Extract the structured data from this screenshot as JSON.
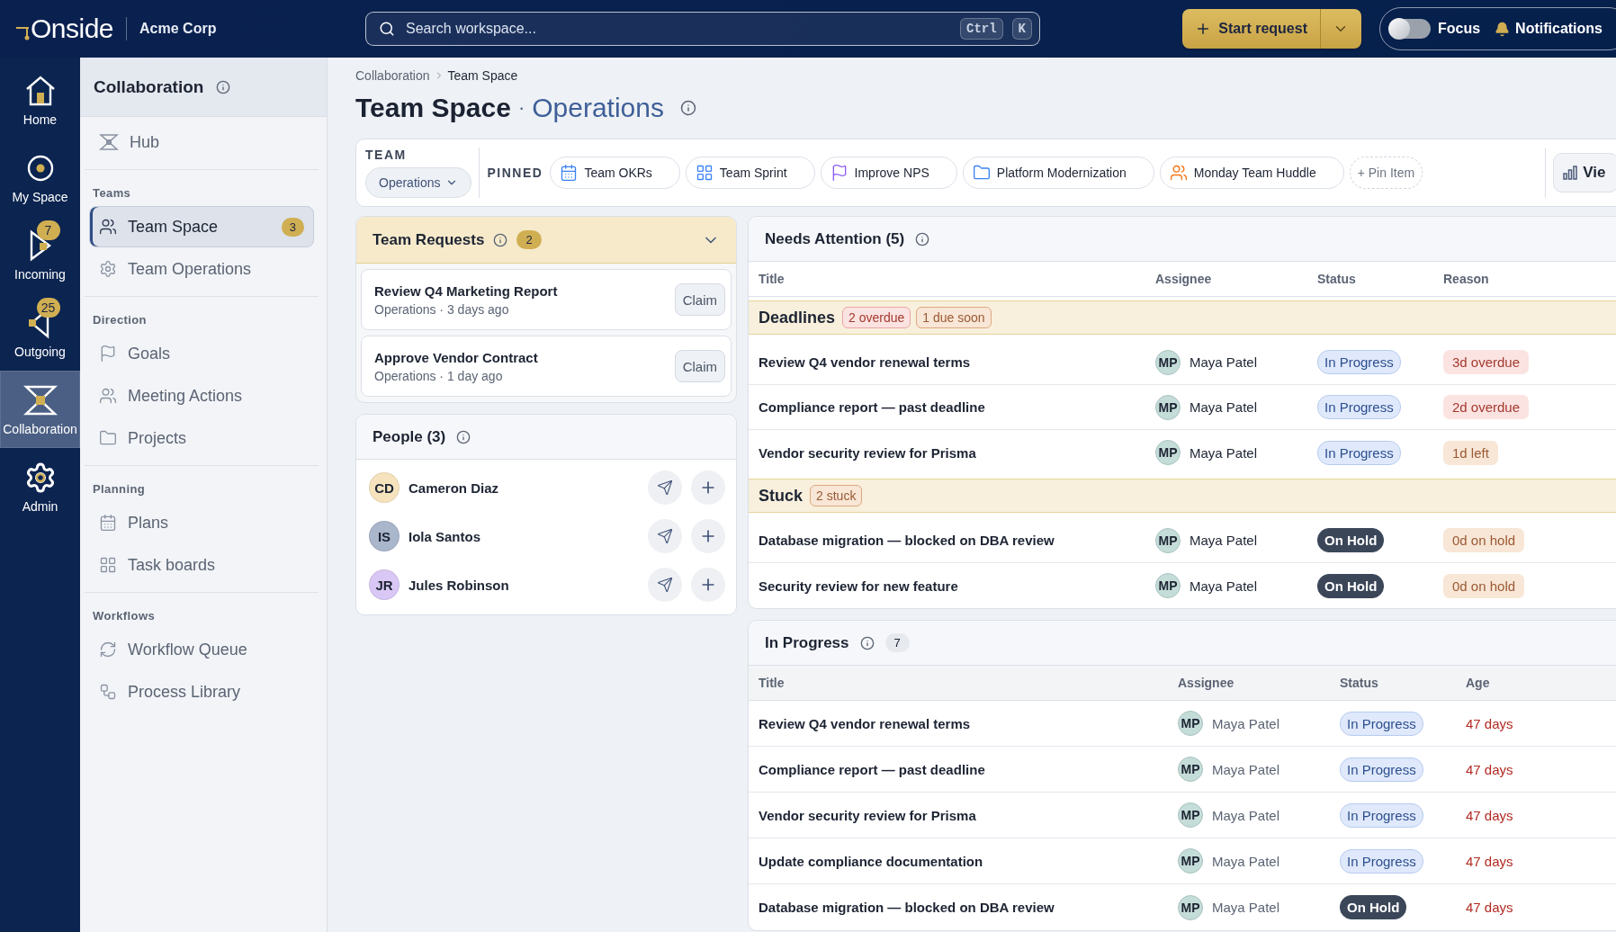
{
  "topbar": {
    "logo": "Onside",
    "org": "Acme Corp",
    "search": {
      "placeholder": "Search workspace...",
      "keys": [
        "Ctrl",
        "K"
      ]
    },
    "primary_action": "Start request",
    "focus": {
      "label": "Focus",
      "on": false
    },
    "notifications": "Notifications"
  },
  "rail": [
    {
      "label": "Home",
      "kind": "home",
      "selected": false
    },
    {
      "label": "My Space",
      "kind": "target",
      "selected": false
    },
    {
      "label": "Incoming",
      "kind": "incoming",
      "badge": "7",
      "selected": false
    },
    {
      "label": "Outgoing",
      "kind": "outgoing",
      "badge": "25",
      "selected": false
    },
    {
      "label": "Collaboration",
      "kind": "collab",
      "selected": true
    },
    {
      "label": "Admin",
      "kind": "gear",
      "selected": false
    }
  ],
  "sidebar": {
    "title": "Collaboration",
    "groups": [
      {
        "items": [
          {
            "label": "Hub",
            "kind": "hub",
            "selected": false
          }
        ]
      },
      {
        "title": "Teams",
        "items": [
          {
            "label": "Team Space",
            "kind": "users",
            "badge": "3",
            "selected": true
          },
          {
            "label": "Team Operations",
            "kind": "gear",
            "selected": false
          }
        ]
      },
      {
        "title": "Direction",
        "items": [
          {
            "label": "Goals",
            "kind": "flag",
            "selected": false
          },
          {
            "label": "Meeting Actions",
            "kind": "group",
            "selected": false
          },
          {
            "label": "Projects",
            "kind": "folder",
            "selected": false
          }
        ]
      },
      {
        "title": "Planning",
        "items": [
          {
            "label": "Plans",
            "kind": "calendar",
            "selected": false
          },
          {
            "label": "Task boards",
            "kind": "grid",
            "selected": false
          }
        ]
      },
      {
        "title": "Workflows",
        "items": [
          {
            "label": "Workflow Queue",
            "kind": "refresh",
            "selected": false
          },
          {
            "label": "Process Library",
            "kind": "workflow",
            "selected": false
          }
        ]
      }
    ]
  },
  "breadcrumb": [
    "Collaboration",
    "Team Space"
  ],
  "page": {
    "title": "Team Space",
    "separator": "·",
    "subtitle": "Operations"
  },
  "filter_bar": {
    "team_label": "TEAM",
    "team": "Operations",
    "pinned_label": "PINNED",
    "pins": [
      {
        "label": "Team OKRs",
        "kind": "calendar"
      },
      {
        "label": "Team Sprint",
        "kind": "grid"
      },
      {
        "label": "Improve NPS",
        "kind": "flag"
      },
      {
        "label": "Platform Modernization",
        "kind": "folder"
      },
      {
        "label": "Monday Team Huddle",
        "kind": "group"
      }
    ],
    "add_pin": "+ Pin Item",
    "view": "Vie"
  },
  "team_requests": {
    "title": "Team Requests",
    "count": "2",
    "expanded": true,
    "items": [
      {
        "title": "Review Q4 Marketing Report",
        "meta": "Operations · 3 days ago",
        "action": "Claim"
      },
      {
        "title": "Approve Vendor Contract",
        "meta": "Operations · 1 day ago",
        "action": "Claim"
      }
    ]
  },
  "people": {
    "title": "People (3)",
    "items": [
      {
        "initials": "CD",
        "name": "Cameron Diaz",
        "color": "#f6e3bd"
      },
      {
        "initials": "IS",
        "name": "Iola Santos",
        "color": "#aab6cc"
      },
      {
        "initials": "JR",
        "name": "Jules Robinson",
        "color": "#d9c8f5"
      }
    ]
  },
  "needs_attention": {
    "title": "Needs Attention (5)",
    "columns": [
      "Title",
      "Assignee",
      "Status",
      "Reason"
    ],
    "groups": [
      {
        "title": "Deadlines",
        "tags": [
          {
            "label": "2 overdue",
            "kind": "danger"
          },
          {
            "label": "1 due soon",
            "kind": "warning"
          }
        ],
        "rows": [
          {
            "title": "Review Q4 vendor renewal terms",
            "initials": "MP",
            "assignee": "Maya Patel",
            "status": {
              "label": "In Progress",
              "kind": "active"
            },
            "reason": {
              "label": "3d overdue",
              "kind": "danger"
            }
          },
          {
            "title": "Compliance report — past deadline",
            "initials": "MP",
            "assignee": "Maya Patel",
            "status": {
              "label": "In Progress",
              "kind": "active"
            },
            "reason": {
              "label": "2d overdue",
              "kind": "danger"
            }
          },
          {
            "title": "Vendor security review for Prisma",
            "initials": "MP",
            "assignee": "Maya Patel",
            "status": {
              "label": "In Progress",
              "kind": "active"
            },
            "reason": {
              "label": "1d left",
              "kind": "warning"
            }
          }
        ]
      },
      {
        "title": "Stuck",
        "tags": [
          {
            "label": "2 stuck",
            "kind": "warning"
          }
        ],
        "rows": [
          {
            "title": "Database migration — blocked on DBA review",
            "initials": "MP",
            "assignee": "Maya Patel",
            "status": {
              "label": "On Hold",
              "kind": "hold"
            },
            "reason": {
              "label": "0d on hold",
              "kind": "warning"
            }
          },
          {
            "title": "Security review for new feature",
            "initials": "MP",
            "assignee": "Maya Patel",
            "status": {
              "label": "On Hold",
              "kind": "hold"
            },
            "reason": {
              "label": "0d on hold",
              "kind": "warning"
            }
          }
        ]
      }
    ]
  },
  "in_progress": {
    "title": "In Progress",
    "count": "7",
    "columns": [
      "Title",
      "Assignee",
      "Status",
      "Age"
    ],
    "rows": [
      {
        "title": "Review Q4 vendor renewal terms",
        "initials": "MP",
        "assignee": "Maya Patel",
        "status": {
          "label": "In Progress",
          "kind": "active"
        },
        "age": "47 days"
      },
      {
        "title": "Compliance report — past deadline",
        "initials": "MP",
        "assignee": "Maya Patel",
        "status": {
          "label": "In Progress",
          "kind": "active"
        },
        "age": "47 days"
      },
      {
        "title": "Vendor security review for Prisma",
        "initials": "MP",
        "assignee": "Maya Patel",
        "status": {
          "label": "In Progress",
          "kind": "active"
        },
        "age": "47 days"
      },
      {
        "title": "Update compliance documentation",
        "initials": "MP",
        "assignee": "Maya Patel",
        "status": {
          "label": "In Progress",
          "kind": "active"
        },
        "age": "47 days"
      },
      {
        "title": "Database migration — blocked on DBA review",
        "initials": "MP",
        "assignee": "Maya Patel",
        "status": {
          "label": "On Hold",
          "kind": "hold"
        },
        "age": "47 days"
      }
    ]
  }
}
